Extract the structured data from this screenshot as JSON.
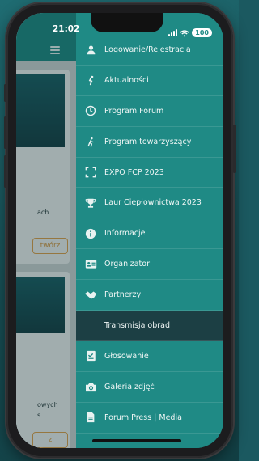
{
  "status_bar": {
    "time": "21:02",
    "battery": "100"
  },
  "background_page": {
    "snippet_1": "ach",
    "button_1": "twórz",
    "snippet_2a": "owych",
    "snippet_2b": "s...",
    "button_2": "z"
  },
  "menu": {
    "items": [
      {
        "label": "Logowanie/Rejestracja",
        "icon": "person-icon",
        "active": false
      },
      {
        "label": "Aktualności",
        "icon": "runner-small-icon",
        "active": false
      },
      {
        "label": "Program Forum",
        "icon": "clock-icon",
        "active": false
      },
      {
        "label": "Program towarzyszący",
        "icon": "walking-person-icon",
        "active": false
      },
      {
        "label": "EXPO FCP 2023",
        "icon": "expand-corners-icon",
        "active": false
      },
      {
        "label": "Laur Ciepłownictwa 2023",
        "icon": "trophy-icon",
        "active": false
      },
      {
        "label": "Informacje",
        "icon": "info-icon",
        "active": false
      },
      {
        "label": "Organizator",
        "icon": "id-card-icon",
        "active": false
      },
      {
        "label": "Partnerzy",
        "icon": "handshake-icon",
        "active": false
      },
      {
        "label": "Transmisja obrad",
        "icon": "",
        "active": true
      },
      {
        "label": "Głosowanie",
        "icon": "ballot-icon",
        "active": false
      },
      {
        "label": "Galeria zdjęć",
        "icon": "camera-icon",
        "active": false
      },
      {
        "label": "Forum Press | Media",
        "icon": "document-icon",
        "active": false
      }
    ]
  },
  "colors": {
    "drawer_bg": "#1f8a85",
    "active_item_bg": "#1c3f44",
    "accent_orange": "#d79a45"
  }
}
